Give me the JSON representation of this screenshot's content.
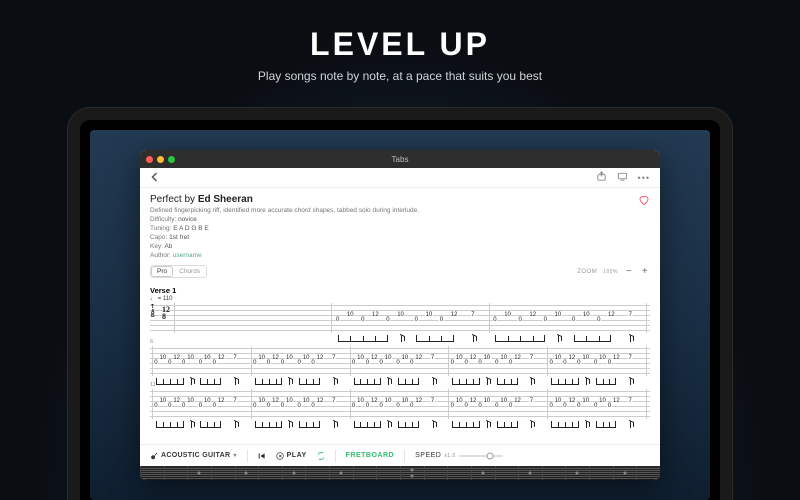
{
  "hero": {
    "title": "LEVEL UP",
    "subtitle": "Play songs note by note, at a pace that suits you best"
  },
  "window": {
    "title": "Tabs"
  },
  "song": {
    "title_prefix": "Perfect by ",
    "artist": "Ed Sheeran",
    "description": "Defined fingerpicking riff, identified more accurate chord shapes, tabbed solo during interlude.",
    "difficulty_label": "Difficulty:",
    "difficulty": "novice",
    "tuning_label": "Tuning:",
    "tuning": "E A D G B E",
    "capo_label": "Capo:",
    "capo": "1st fret",
    "key_label": "Key:",
    "key": "Ab",
    "author_label": "Author:",
    "author": "username"
  },
  "viewmode": {
    "pro": "Pro",
    "chords": "Chords"
  },
  "zoom": {
    "label": "ZOOM",
    "value": "100%",
    "minus": "−",
    "plus": "+"
  },
  "section": {
    "verse_label": "Verse 1",
    "tempo": "♩ = 110",
    "time_top": "12",
    "time_bot": "8"
  },
  "barnums": {
    "b2": "6",
    "b3": "11"
  },
  "tab": {
    "lines": [
      {
        "bars": [
          {
            "notes": []
          },
          {
            "notes": [
              {
                "s": 3,
                "f": "0",
                "x": 4
              },
              {
                "s": 2,
                "f": "10",
                "x": 12
              },
              {
                "s": 3,
                "f": "0",
                "x": 20
              },
              {
                "s": 2,
                "f": "12",
                "x": 28
              },
              {
                "s": 3,
                "f": "0",
                "x": 36
              },
              {
                "s": 2,
                "f": "10",
                "x": 44
              },
              {
                "s": 3,
                "f": "0",
                "x": 54
              },
              {
                "s": 2,
                "f": "10",
                "x": 62
              },
              {
                "s": 3,
                "f": "0",
                "x": 70
              },
              {
                "s": 2,
                "f": "12",
                "x": 78
              },
              {
                "s": 2,
                "f": "7",
                "x": 90
              }
            ]
          },
          {
            "notes": [
              {
                "s": 3,
                "f": "0",
                "x": 4
              },
              {
                "s": 2,
                "f": "10",
                "x": 12
              },
              {
                "s": 3,
                "f": "0",
                "x": 20
              },
              {
                "s": 2,
                "f": "12",
                "x": 28
              },
              {
                "s": 3,
                "f": "0",
                "x": 36
              },
              {
                "s": 2,
                "f": "10",
                "x": 44
              },
              {
                "s": 3,
                "f": "0",
                "x": 54
              },
              {
                "s": 2,
                "f": "10",
                "x": 62
              },
              {
                "s": 3,
                "f": "0",
                "x": 70
              },
              {
                "s": 2,
                "f": "12",
                "x": 78
              },
              {
                "s": 2,
                "f": "7",
                "x": 90
              }
            ]
          }
        ]
      },
      {
        "bars": [
          {
            "notes": [
              {
                "s": 3,
                "f": "0",
                "x": 4
              },
              {
                "s": 2,
                "f": "10",
                "x": 11
              },
              {
                "s": 3,
                "f": "0",
                "x": 18
              },
              {
                "s": 2,
                "f": "12",
                "x": 25
              },
              {
                "s": 3,
                "f": "0",
                "x": 32
              },
              {
                "s": 2,
                "f": "10",
                "x": 39
              },
              {
                "s": 3,
                "f": "0",
                "x": 49
              },
              {
                "s": 2,
                "f": "10",
                "x": 56
              },
              {
                "s": 3,
                "f": "0",
                "x": 63
              },
              {
                "s": 2,
                "f": "12",
                "x": 70
              },
              {
                "s": 2,
                "f": "7",
                "x": 84
              }
            ]
          },
          {
            "notes": [
              {
                "s": 3,
                "f": "0",
                "x": 4
              },
              {
                "s": 2,
                "f": "10",
                "x": 11
              },
              {
                "s": 3,
                "f": "0",
                "x": 18
              },
              {
                "s": 2,
                "f": "12",
                "x": 25
              },
              {
                "s": 3,
                "f": "0",
                "x": 32
              },
              {
                "s": 2,
                "f": "10",
                "x": 39
              },
              {
                "s": 3,
                "f": "0",
                "x": 49
              },
              {
                "s": 2,
                "f": "10",
                "x": 56
              },
              {
                "s": 3,
                "f": "0",
                "x": 63
              },
              {
                "s": 2,
                "f": "12",
                "x": 70
              },
              {
                "s": 2,
                "f": "7",
                "x": 84
              }
            ]
          },
          {
            "notes": [
              {
                "s": 3,
                "f": "0",
                "x": 4
              },
              {
                "s": 2,
                "f": "10",
                "x": 11
              },
              {
                "s": 3,
                "f": "0",
                "x": 18
              },
              {
                "s": 2,
                "f": "12",
                "x": 25
              },
              {
                "s": 3,
                "f": "0",
                "x": 32
              },
              {
                "s": 2,
                "f": "10",
                "x": 39
              },
              {
                "s": 3,
                "f": "0",
                "x": 49
              },
              {
                "s": 2,
                "f": "10",
                "x": 56
              },
              {
                "s": 3,
                "f": "0",
                "x": 63
              },
              {
                "s": 2,
                "f": "12",
                "x": 70
              },
              {
                "s": 2,
                "f": "7",
                "x": 84
              }
            ]
          },
          {
            "notes": [
              {
                "s": 3,
                "f": "0",
                "x": 4
              },
              {
                "s": 2,
                "f": "10",
                "x": 11
              },
              {
                "s": 3,
                "f": "0",
                "x": 18
              },
              {
                "s": 2,
                "f": "12",
                "x": 25
              },
              {
                "s": 3,
                "f": "0",
                "x": 32
              },
              {
                "s": 2,
                "f": "10",
                "x": 39
              },
              {
                "s": 3,
                "f": "0",
                "x": 49
              },
              {
                "s": 2,
                "f": "10",
                "x": 56
              },
              {
                "s": 3,
                "f": "0",
                "x": 63
              },
              {
                "s": 2,
                "f": "12",
                "x": 70
              },
              {
                "s": 2,
                "f": "7",
                "x": 84
              }
            ]
          },
          {
            "notes": [
              {
                "s": 3,
                "f": "0",
                "x": 4
              },
              {
                "s": 2,
                "f": "10",
                "x": 11
              },
              {
                "s": 3,
                "f": "0",
                "x": 18
              },
              {
                "s": 2,
                "f": "12",
                "x": 25
              },
              {
                "s": 3,
                "f": "0",
                "x": 32
              },
              {
                "s": 2,
                "f": "10",
                "x": 39
              },
              {
                "s": 3,
                "f": "0",
                "x": 49
              },
              {
                "s": 2,
                "f": "10",
                "x": 56
              },
              {
                "s": 3,
                "f": "0",
                "x": 63
              },
              {
                "s": 2,
                "f": "12",
                "x": 70
              },
              {
                "s": 2,
                "f": "7",
                "x": 84
              }
            ]
          }
        ]
      },
      {
        "bars": [
          {
            "notes": [
              {
                "s": 3,
                "f": "0",
                "x": 4
              },
              {
                "s": 2,
                "f": "10",
                "x": 11
              },
              {
                "s": 3,
                "f": "0",
                "x": 18
              },
              {
                "s": 2,
                "f": "12",
                "x": 25
              },
              {
                "s": 3,
                "f": "0",
                "x": 32
              },
              {
                "s": 2,
                "f": "10",
                "x": 39
              },
              {
                "s": 3,
                "f": "0",
                "x": 49
              },
              {
                "s": 2,
                "f": "10",
                "x": 56
              },
              {
                "s": 3,
                "f": "0",
                "x": 63
              },
              {
                "s": 2,
                "f": "12",
                "x": 70
              },
              {
                "s": 2,
                "f": "7",
                "x": 84
              }
            ]
          },
          {
            "notes": [
              {
                "s": 3,
                "f": "0",
                "x": 4
              },
              {
                "s": 2,
                "f": "10",
                "x": 11
              },
              {
                "s": 3,
                "f": "0",
                "x": 18
              },
              {
                "s": 2,
                "f": "12",
                "x": 25
              },
              {
                "s": 3,
                "f": "0",
                "x": 32
              },
              {
                "s": 2,
                "f": "10",
                "x": 39
              },
              {
                "s": 3,
                "f": "0",
                "x": 49
              },
              {
                "s": 2,
                "f": "10",
                "x": 56
              },
              {
                "s": 3,
                "f": "0",
                "x": 63
              },
              {
                "s": 2,
                "f": "12",
                "x": 70
              },
              {
                "s": 2,
                "f": "7",
                "x": 84
              }
            ]
          },
          {
            "notes": [
              {
                "s": 3,
                "f": "0",
                "x": 4
              },
              {
                "s": 2,
                "f": "10",
                "x": 11
              },
              {
                "s": 3,
                "f": "0",
                "x": 18
              },
              {
                "s": 2,
                "f": "12",
                "x": 25
              },
              {
                "s": 3,
                "f": "0",
                "x": 32
              },
              {
                "s": 2,
                "f": "10",
                "x": 39
              },
              {
                "s": 3,
                "f": "0",
                "x": 49
              },
              {
                "s": 2,
                "f": "10",
                "x": 56
              },
              {
                "s": 3,
                "f": "0",
                "x": 63
              },
              {
                "s": 2,
                "f": "12",
                "x": 70
              },
              {
                "s": 2,
                "f": "7",
                "x": 84
              }
            ]
          },
          {
            "notes": [
              {
                "s": 3,
                "f": "0",
                "x": 4
              },
              {
                "s": 2,
                "f": "10",
                "x": 11
              },
              {
                "s": 3,
                "f": "0",
                "x": 18
              },
              {
                "s": 2,
                "f": "12",
                "x": 25
              },
              {
                "s": 3,
                "f": "0",
                "x": 32
              },
              {
                "s": 2,
                "f": "10",
                "x": 39
              },
              {
                "s": 3,
                "f": "0",
                "x": 49
              },
              {
                "s": 2,
                "f": "10",
                "x": 56
              },
              {
                "s": 3,
                "f": "0",
                "x": 63
              },
              {
                "s": 2,
                "f": "12",
                "x": 70
              },
              {
                "s": 2,
                "f": "7",
                "x": 84
              }
            ]
          },
          {
            "notes": [
              {
                "s": 3,
                "f": "0",
                "x": 4
              },
              {
                "s": 2,
                "f": "10",
                "x": 11
              },
              {
                "s": 3,
                "f": "0",
                "x": 18
              },
              {
                "s": 2,
                "f": "12",
                "x": 25
              },
              {
                "s": 3,
                "f": "0",
                "x": 32
              },
              {
                "s": 2,
                "f": "10",
                "x": 39
              },
              {
                "s": 3,
                "f": "0",
                "x": 49
              },
              {
                "s": 2,
                "f": "10",
                "x": 56
              },
              {
                "s": 3,
                "f": "0",
                "x": 63
              },
              {
                "s": 2,
                "f": "12",
                "x": 70
              },
              {
                "s": 2,
                "f": "7",
                "x": 84
              }
            ]
          }
        ]
      }
    ]
  },
  "controls": {
    "instrument": "ACOUSTIC GUITAR",
    "play": "PLAY",
    "fretboard": "FRETBOARD",
    "speed_label": "SPEED",
    "speed_value": "x1.0"
  }
}
